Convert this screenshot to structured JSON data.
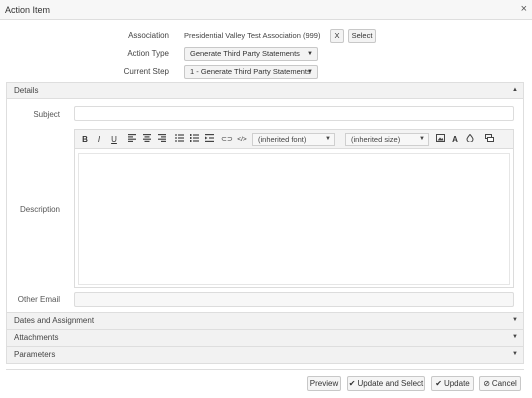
{
  "window": {
    "title": "Action Item",
    "close_glyph": "×"
  },
  "association": {
    "label": "Association",
    "value": "Presidential Valley Test Association (999)",
    "clear_label": "X",
    "select_label": "Select"
  },
  "action_type": {
    "label": "Action Type",
    "value": "Generate Third Party Statements"
  },
  "current_step": {
    "label": "Current Step",
    "value": "1 - Generate Third Party Statements"
  },
  "details": {
    "header": "Details",
    "subject_label": "Subject",
    "subject_value": "",
    "description_label": "Description",
    "other_email_label": "Other Email",
    "other_email_value": ""
  },
  "editor_toolbar": {
    "bold": "B",
    "italic": "I",
    "underline": "U",
    "font_value": "(inherited font)",
    "size_value": "(inherited size)",
    "font_color": "A",
    "link_glyph": "⊂⊃",
    "code_glyph": "</>"
  },
  "sections": [
    {
      "label": "Dates and Assignment"
    },
    {
      "label": "Attachments"
    },
    {
      "label": "Parameters"
    }
  ],
  "footer": {
    "preview_label": "Preview",
    "update_select_label": "Update and Select",
    "update_label": "Update",
    "cancel_label": "Cancel"
  },
  "icons": {
    "caret_down": "▼",
    "caret_up": "▲"
  }
}
